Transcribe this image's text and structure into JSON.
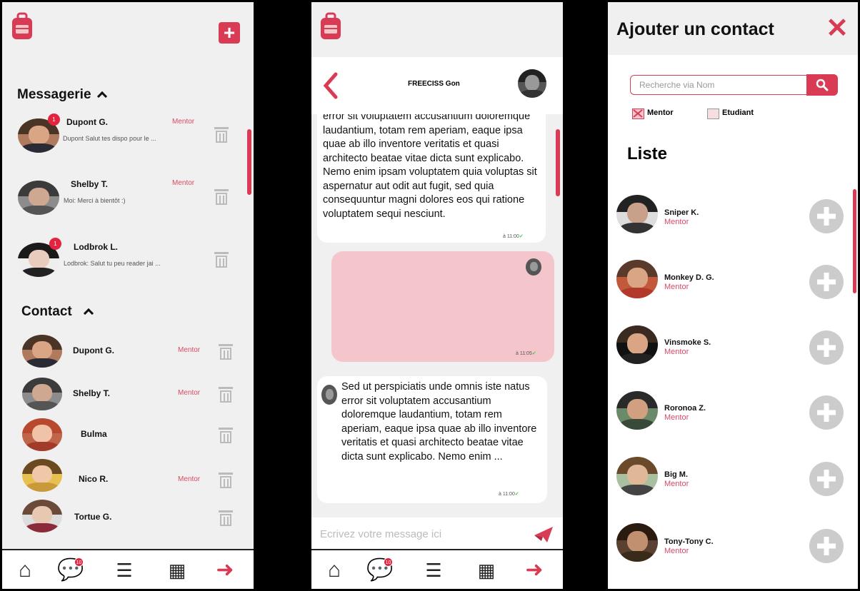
{
  "colors": {
    "accent": "#d93b54",
    "badge": "#e3243f",
    "bubble_pink": "#f4c6cc"
  },
  "screen1": {
    "messagerie_title": "Messagerie",
    "conversations": [
      {
        "name": "Dupont G.",
        "role": "Mentor",
        "preview": "Dupont   Salut tes dispo pour le ...",
        "badge": "1"
      },
      {
        "name": "Shelby T.",
        "role": "Mentor",
        "preview": "Moi:   Merci à bientôt :)",
        "badge": ""
      },
      {
        "name": "Lodbrok L.",
        "role": "",
        "preview": "Lodbrok:   Salut tu peu reader jai ...",
        "badge": "1"
      }
    ],
    "contact_title": "Contact",
    "contacts": [
      {
        "name": "Dupont G.",
        "role": "Mentor"
      },
      {
        "name": "Shelby T.",
        "role": "Mentor"
      },
      {
        "name": "Bulma",
        "role": ""
      },
      {
        "name": "Nico R.",
        "role": "Mentor"
      },
      {
        "name": "Tortue G.",
        "role": ""
      }
    ]
  },
  "tabbar": {
    "chat_badge": "10"
  },
  "screen2": {
    "header_name": "FREECISS Gon",
    "msg1": "error sit voluptatem accusantium doloremque laudantium, totam rem aperiam, eaque ipsa quae ab illo inventore veritatis et quasi architecto beatae vitae dicta sunt explicabo. Nemo enim ipsam voluptatem quia voluptas sit aspernatur aut odit aut fugit, sed quia consequuntur magni dolores eos qui ratione voluptatem sequi nesciunt.",
    "msg1_time": "à 11:00",
    "msg2_time": "à 11:05",
    "msg3": "Sed ut perspiciatis unde omnis iste natus error sit voluptatem accusantium doloremque laudantium, totam rem aperiam, eaque ipsa quae ab illo inventore veritatis et quasi architecto beatae vitae dicta sunt explicabo. Nemo enim ...",
    "msg3_time": "à 11:00",
    "input_placeholder": "Ecrivez votre message ici"
  },
  "screen3": {
    "title": "Ajouter un contact",
    "search_placeholder": "Recherche via Nom",
    "filter_mentor": "Mentor",
    "filter_etudiant": "Etudiant",
    "list_title": "Liste",
    "people": [
      {
        "name": "Sniper K.",
        "role": "Mentor"
      },
      {
        "name": "Monkey D. G.",
        "role": "Mentor"
      },
      {
        "name": "Vinsmoke S.",
        "role": "Mentor"
      },
      {
        "name": "Roronoa Z.",
        "role": "Mentor"
      },
      {
        "name": "Big M.",
        "role": "Mentor"
      },
      {
        "name": "Tony-Tony C.",
        "role": "Mentor"
      }
    ]
  }
}
